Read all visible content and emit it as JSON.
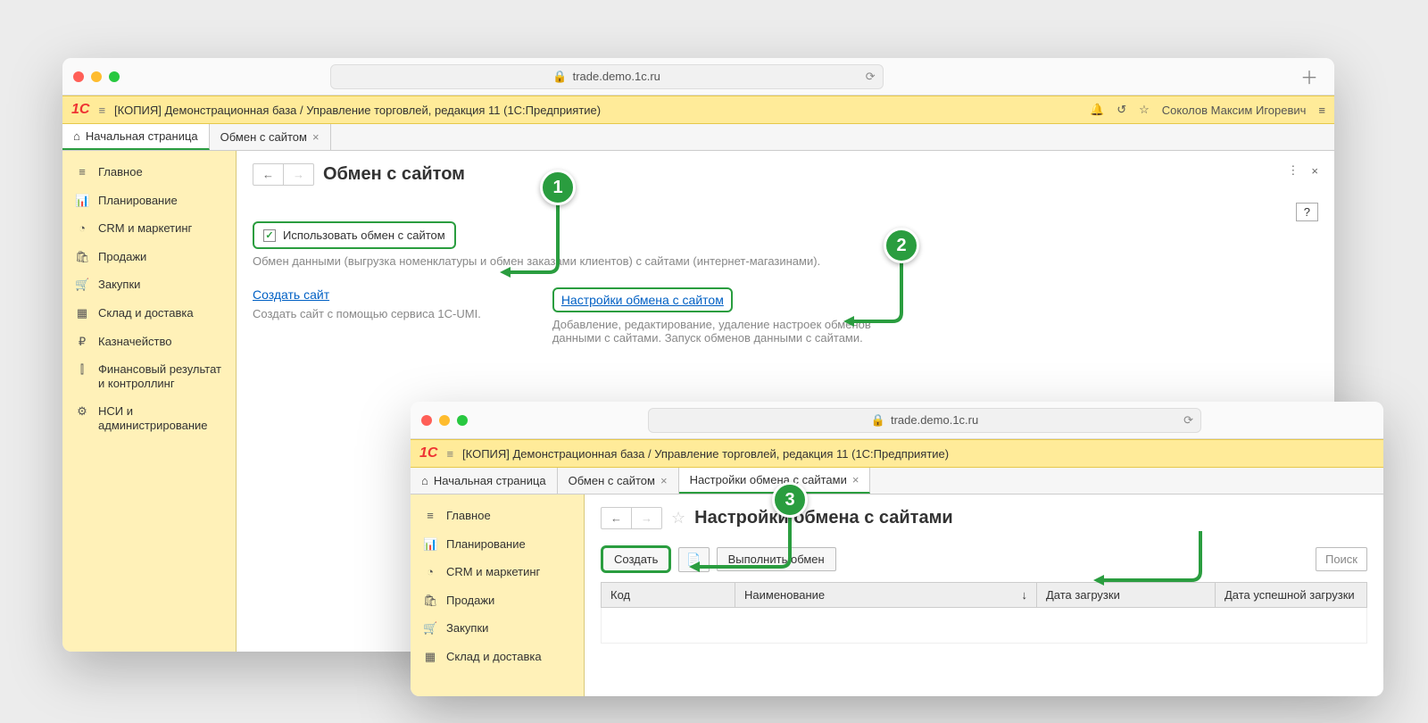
{
  "url": "trade.demo.1c.ru",
  "app_title": "[КОПИЯ] Демонстрационная база / Управление торговлей, редакция 11  (1С:Предприятие)",
  "user_name": "Соколов Максим Игоревич",
  "help": "?",
  "sidebar": [
    {
      "label": "Главное",
      "icon": "≡"
    },
    {
      "label": "Планирование",
      "icon": "📊"
    },
    {
      "label": "CRM и маркетинг",
      "icon": "◔"
    },
    {
      "label": "Продажи",
      "icon": "🛍"
    },
    {
      "label": "Закупки",
      "icon": "🛒"
    },
    {
      "label": "Склад и доставка",
      "icon": "▦"
    },
    {
      "label": "Казначейство",
      "icon": "₽"
    },
    {
      "label": "Финансовый результат и контроллинг",
      "icon": "⫿"
    },
    {
      "label": "НСИ и администрирование",
      "icon": "⚙"
    }
  ],
  "win1": {
    "tabs": {
      "home": "Начальная страница",
      "t1": "Обмен с сайтом"
    },
    "page_title": "Обмен с сайтом",
    "checkbox_label": "Использовать обмен с сайтом",
    "checkbox_desc": "Обмен данными (выгрузка номенклатуры и обмен заказами клиентов) с сайтами (интернет-магазинами).",
    "link1": "Создать сайт",
    "link1_desc": "Создать сайт с помощью сервиса 1C-UMI.",
    "link2": "Настройки обмена с сайтом",
    "link2_desc": "Добавление, редактирование, удаление настроек обменов данными с сайтами. Запуск обменов данными с сайтами."
  },
  "win2": {
    "tabs": {
      "home": "Начальная страница",
      "t1": "Обмен с сайтом",
      "t2": "Настройки обмена с сайтами"
    },
    "page_title": "Настройки обмена с сайтами",
    "btn_create": "Создать",
    "btn_exchange": "Выполнить обмен",
    "search_placeholder": "Поиск",
    "columns": {
      "c1": "Код",
      "c2": "Наименование",
      "c2_sort": "↓",
      "c3": "Дата загрузки",
      "c4": "Дата успешной загрузки"
    }
  },
  "callouts": {
    "n1": "1",
    "n2": "2",
    "n3": "3"
  }
}
